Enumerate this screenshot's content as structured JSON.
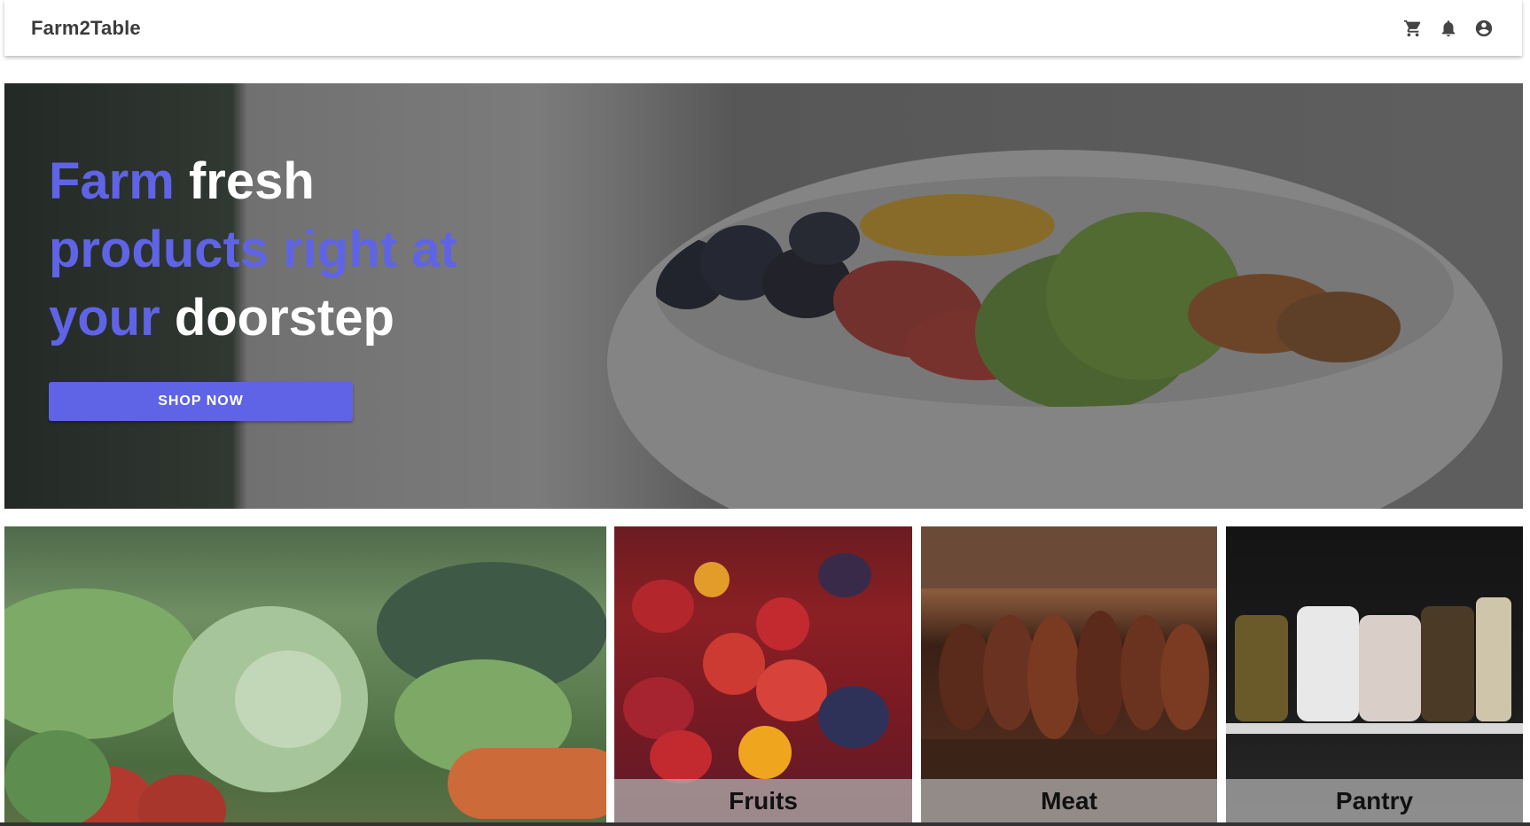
{
  "app": {
    "brand": "Farm2Table"
  },
  "header_icons": [
    "cart-icon",
    "bell-icon",
    "account-circle-icon"
  ],
  "hero": {
    "headline_words": [
      {
        "text": "Farm ",
        "color": "#5f64e6"
      },
      {
        "text": "fresh",
        "color": "#ffffff"
      },
      {
        "text": "products right at",
        "color": "#5f64e6"
      },
      {
        "text": "your ",
        "color": "#5f64e6"
      },
      {
        "text": "doorstep",
        "color": "#ffffff"
      }
    ],
    "w0": "Farm ",
    "w1": "fresh",
    "w2": "products right at",
    "w3": "your ",
    "w4": "doorstep",
    "cta_label": "SHOP NOW"
  },
  "categories": {
    "fruits": "Fruits",
    "meat": "Meat",
    "pantry": "Pantry"
  },
  "colors": {
    "accent": "#5f64e6",
    "brand_text": "#3b3b3b"
  }
}
